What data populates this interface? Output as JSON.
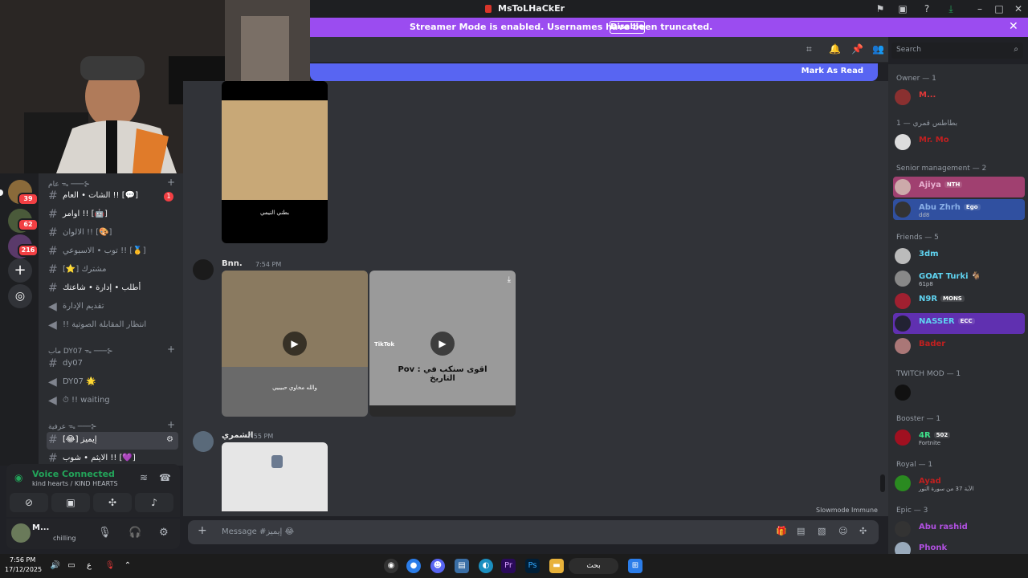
{
  "window": {
    "title": "MsToLHaCkEr"
  },
  "banner": {
    "text": "Streamer Mode is enabled. Usernames have been truncated.",
    "disable_label": "Disable"
  },
  "mark_read": {
    "label": "Mark As Read"
  },
  "search": {
    "placeholder": "Search"
  },
  "servers": [
    {
      "badge": "39"
    },
    {
      "badge": "62"
    },
    {
      "badge": "216"
    }
  ],
  "channels": {
    "cat1": "عام ᯓ ───⊱",
    "items1": [
      {
        "label": "الشات • العام !! [💬]",
        "badge": "1"
      },
      {
        "label": "اوامر !! [🤖]"
      },
      {
        "label": "الالوان !! [🎨]"
      },
      {
        "label": "توب • الاسبوعي !! [🥇]"
      },
      {
        "label": "[⭐] مشترك"
      },
      {
        "label": "أطلب • إدارة • شاعتك"
      },
      {
        "label": "تقديم الإدارة"
      },
      {
        "label": "!! انتظار المقابلة الصوتية"
      }
    ],
    "cat2": "ماب DY07 ᯓ ───⊱",
    "items2": [
      {
        "label": "dy07"
      },
      {
        "label": "DY07 🌟"
      },
      {
        "label": "⏱ !! waiting"
      }
    ],
    "cat3": "عرفية ᯓ ───⊱",
    "items3": [
      {
        "label": "[😂] إيميز"
      },
      {
        "label": "الايثم • شوب !! [💜]"
      }
    ]
  },
  "voice": {
    "status": "Voice Connected",
    "sub": "kind hearts / KIND HEARTS"
  },
  "user": {
    "name": "M...",
    "status": "chilling"
  },
  "messages": [
    {
      "author": "",
      "time": "",
      "caption": "بطني النيمي"
    },
    {
      "author": "Bnn.",
      "time": "7:54 PM",
      "caption1": "والله مخاوي حبيبيي",
      "caption2": "Pov : اقوى سنكب في التاريخ",
      "tiktok": "TikTok"
    },
    {
      "author": "الشمري",
      "time": "7:55 PM"
    }
  ],
  "composer": {
    "placeholder": "Message #إيميز 😂"
  },
  "slowmode": {
    "label": "Slowmode Immune"
  },
  "members": {
    "groups": [
      {
        "label": "Owner — 1",
        "people": [
          {
            "name": "M...",
            "color": "#e03838"
          }
        ]
      },
      {
        "label": "بطاطس قمري — 1",
        "people": [
          {
            "name": "Mr. Mo",
            "color": "#c02020"
          }
        ]
      },
      {
        "label": "Senior management — 2",
        "people": [
          {
            "name": "Ajiya",
            "color": "#e8b0d0",
            "tag": "NTH",
            "bg": "#a04070"
          },
          {
            "name": "Abu Zhrh",
            "color": "#8ab0e8",
            "tag": "Ego",
            "sub": "dd8",
            "bg": "#3050a0"
          }
        ]
      },
      {
        "label": "Friends — 5",
        "people": [
          {
            "name": "3dm",
            "color": "#5fd3f0"
          },
          {
            "name": "GOAT Turki 🐐",
            "color": "#5fd3f0",
            "sub": "61p8"
          },
          {
            "name": "N9R",
            "color": "#5fd3f0",
            "tag": "MONS"
          },
          {
            "name": "NASSER",
            "color": "#5fd3f0",
            "tag": "ECC",
            "bg": "#6030b0"
          },
          {
            "name": "Bader",
            "color": "#c02020"
          }
        ]
      },
      {
        "label": "TWITCH MOD — 1",
        "people": [
          {
            "name": "",
            "color": "#c02020"
          }
        ]
      },
      {
        "label": "Booster — 1",
        "people": [
          {
            "name": "4R",
            "color": "#3ee08a",
            "tag": "502",
            "sub": "Fortnite"
          }
        ]
      },
      {
        "label": "Royal — 1",
        "people": [
          {
            "name": "Ayad",
            "color": "#c02020",
            "sub": "الآية 37 من سورة النور"
          }
        ]
      },
      {
        "label": "Epic — 3",
        "people": [
          {
            "name": "Abu rashid",
            "color": "#b050e0"
          },
          {
            "name": "Phonk",
            "color": "#b050e0"
          }
        ]
      }
    ]
  },
  "taskbar": {
    "time": "7:56 PM",
    "date": "17/12/2025",
    "search": "بحث",
    "lang": "ع"
  }
}
